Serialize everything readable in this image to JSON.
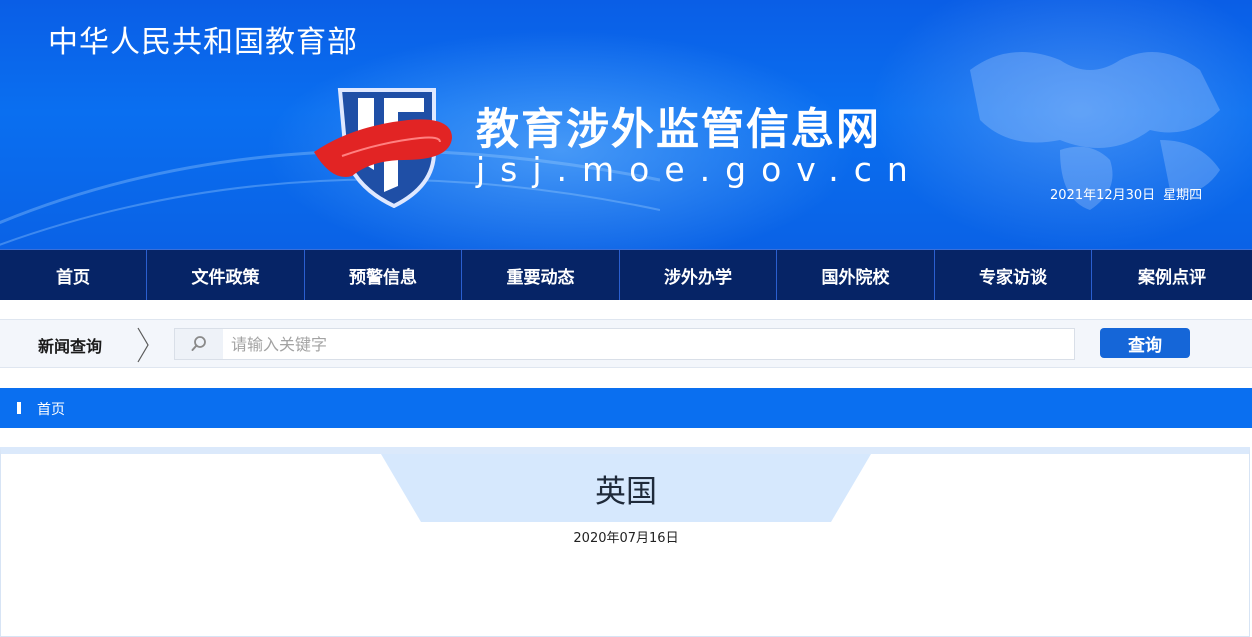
{
  "header": {
    "ministry": "中华人民共和国教育部",
    "site_name": "教育涉外监管信息网",
    "site_domain": "jsj.moe.gov.cn",
    "date": "2021年12月30日",
    "weekday": "星期四"
  },
  "nav": [
    {
      "label": "首页"
    },
    {
      "label": "文件政策"
    },
    {
      "label": "预警信息"
    },
    {
      "label": "重要动态"
    },
    {
      "label": "涉外办学"
    },
    {
      "label": "国外院校"
    },
    {
      "label": "专家访谈"
    },
    {
      "label": "案例点评"
    }
  ],
  "search": {
    "title": "新闻查询",
    "placeholder": "请输入关键字",
    "value": "",
    "button_label": "查询",
    "icon": "search-icon"
  },
  "breadcrumb": {
    "items": [
      "首页"
    ]
  },
  "article": {
    "title": "英国",
    "date": "2020年07月16日"
  },
  "colors": {
    "banner": "#0a6ff0",
    "nav_bg": "#062466",
    "accent": "#1566d8",
    "title_tab": "#d6e8fd"
  }
}
